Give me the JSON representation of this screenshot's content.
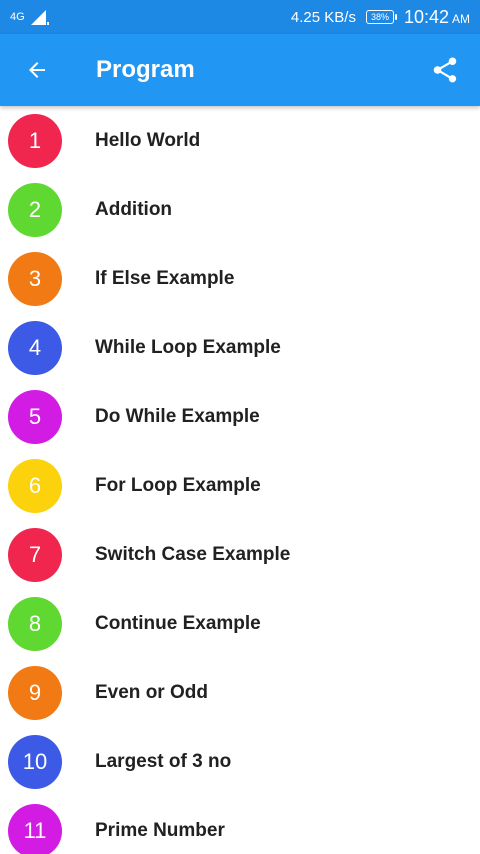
{
  "status_bar": {
    "network": "4G",
    "speed": "4.25 KB/s",
    "battery": "38%",
    "time": "10:42",
    "ampm": "AM"
  },
  "app_bar": {
    "title": "Program",
    "back_icon": "arrow-left-icon",
    "share_icon": "share-icon"
  },
  "colors": {
    "status_bar": "#1e88e5",
    "app_bar": "#2196f3"
  },
  "programs": [
    {
      "number": "1",
      "label": "Hello World",
      "color": "#f0264f"
    },
    {
      "number": "2",
      "label": "Addition",
      "color": "#5fd832"
    },
    {
      "number": "3",
      "label": "If Else Example",
      "color": "#f27a14"
    },
    {
      "number": "4",
      "label": "While Loop Example",
      "color": "#3d5ae6"
    },
    {
      "number": "5",
      "label": "Do While Example",
      "color": "#d21be3"
    },
    {
      "number": "6",
      "label": "For Loop Example",
      "color": "#fcd20c"
    },
    {
      "number": "7",
      "label": "Switch Case Example",
      "color": "#f0264f"
    },
    {
      "number": "8",
      "label": "Continue Example",
      "color": "#5fd832"
    },
    {
      "number": "9",
      "label": "Even or Odd",
      "color": "#f27a14"
    },
    {
      "number": "10",
      "label": "Largest of 3 no",
      "color": "#3d5ae6"
    },
    {
      "number": "11",
      "label": "Prime Number",
      "color": "#d21be3"
    }
  ]
}
